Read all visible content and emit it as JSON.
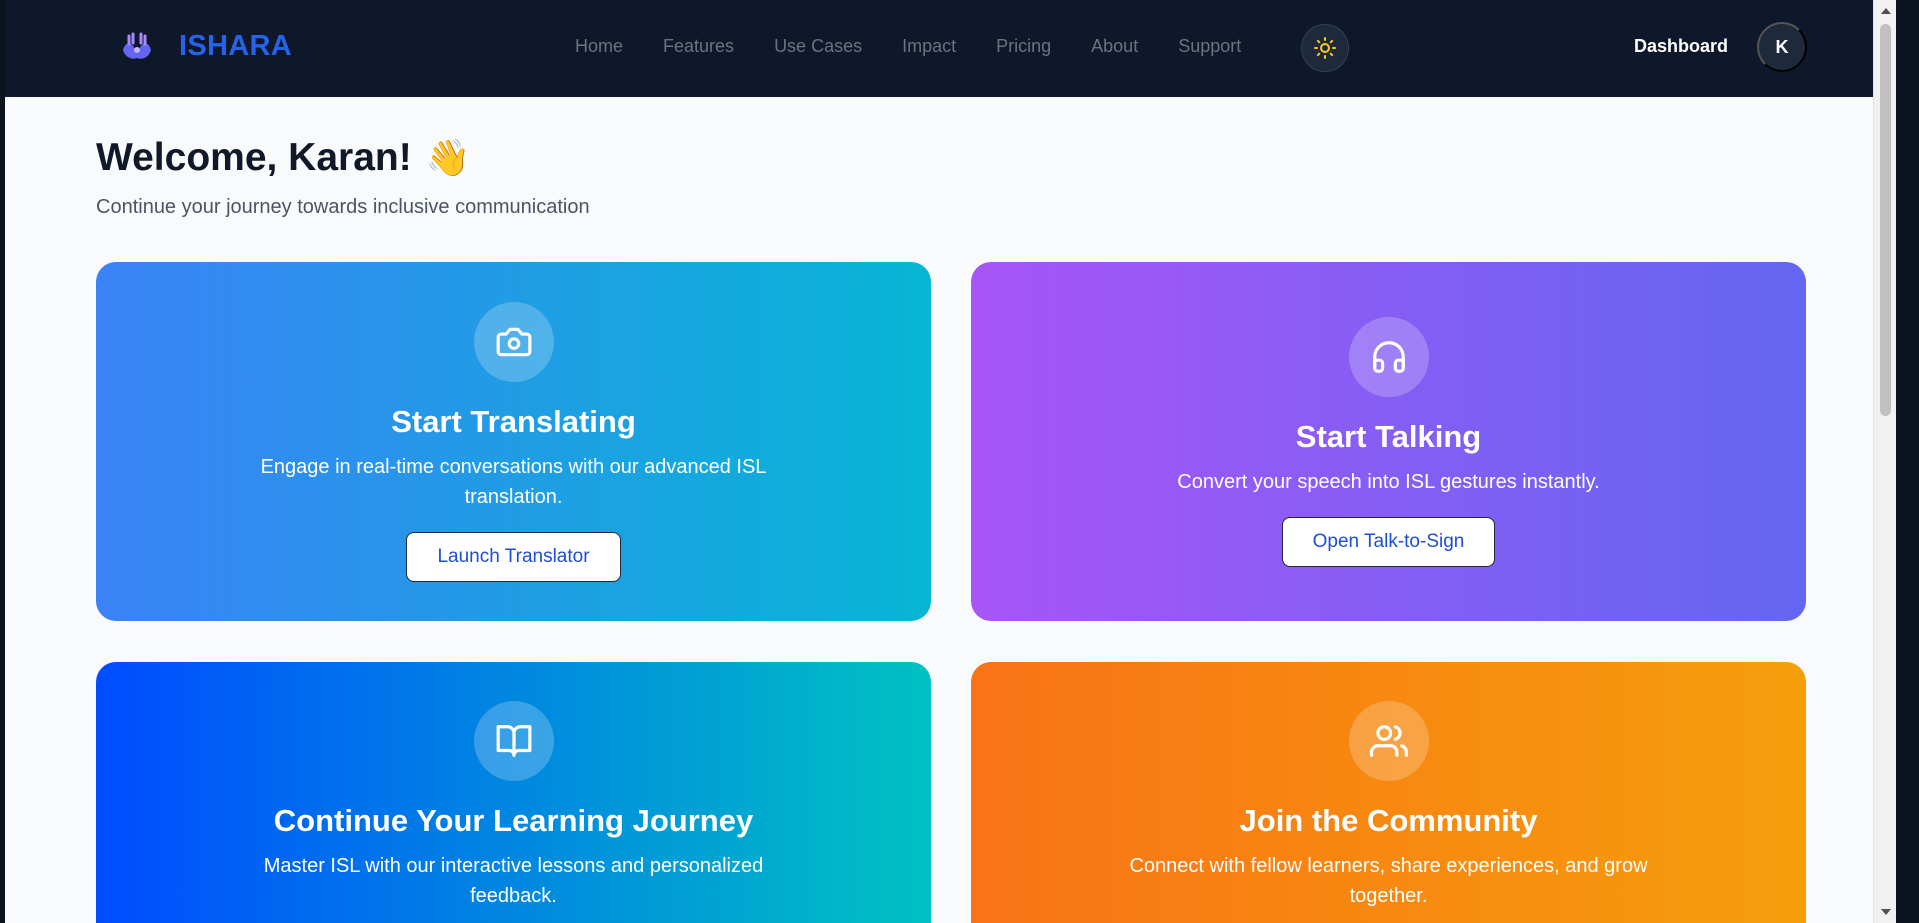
{
  "brand": {
    "name": "ISHARA"
  },
  "nav": {
    "links": [
      "Home",
      "Features",
      "Use Cases",
      "Impact",
      "Pricing",
      "About",
      "Support"
    ],
    "dashboard": "Dashboard",
    "avatar_initial": "K"
  },
  "welcome": {
    "title": "Welcome, Karan!",
    "emoji": "👋",
    "subtitle": "Continue your journey towards inclusive communication"
  },
  "cards": [
    {
      "icon": "camera-icon",
      "title": "Start Translating",
      "description": "Engage in real-time conversations with our advanced ISL translation.",
      "button": "Launch Translator"
    },
    {
      "icon": "headphones-icon",
      "title": "Start Talking",
      "description": "Convert your speech into ISL gestures instantly.",
      "button": "Open Talk-to-Sign"
    },
    {
      "icon": "book-open-icon",
      "title": "Continue Your Learning Journey",
      "description": "Master ISL with our interactive lessons and personalized feedback."
    },
    {
      "icon": "users-icon",
      "title": "Join the Community",
      "description": "Connect with fellow learners, share experiences, and grow together."
    }
  ],
  "colors": {
    "navbar_bg": "#0f172a",
    "brand": "#2563eb",
    "card_translate": [
      "#3b82f6",
      "#06b6d4"
    ],
    "card_talk": [
      "#a855f7",
      "#6366f1"
    ],
    "card_learn": [
      "#004cff",
      "#00c2c2"
    ],
    "card_community": [
      "#f97316",
      "#f59e0b"
    ]
  }
}
